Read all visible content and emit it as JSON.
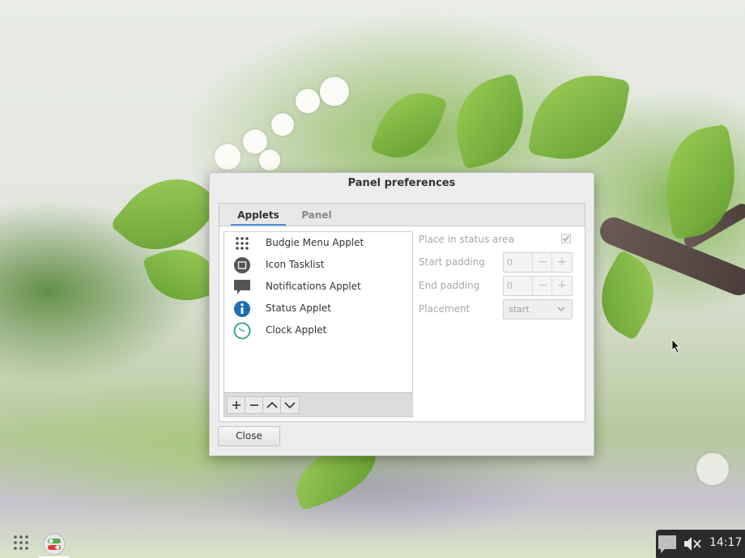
{
  "dialog": {
    "title": "Panel preferences",
    "tabs": [
      {
        "label": "Applets",
        "active": true
      },
      {
        "label": "Panel",
        "active": false
      }
    ],
    "applets": [
      {
        "label": "Budgie Menu Applet",
        "icon": "grid-dots-icon"
      },
      {
        "label": "Icon Tasklist",
        "icon": "tasklist-icon"
      },
      {
        "label": "Notifications Applet",
        "icon": "notification-bubble-icon"
      },
      {
        "label": "Status Applet",
        "icon": "info-icon"
      },
      {
        "label": "Clock Applet",
        "icon": "clock-icon"
      }
    ],
    "list_toolbar": {
      "add_icon": "plus-icon",
      "remove_icon": "minus-icon",
      "move_up_icon": "chevron-up-icon",
      "move_down_icon": "chevron-down-icon"
    },
    "settings": {
      "status_area_label": "Place in status area",
      "status_area_checked": true,
      "start_padding_label": "Start padding",
      "start_padding_value": "0",
      "end_padding_label": "End padding",
      "end_padding_value": "0",
      "placement_label": "Placement",
      "placement_value": "start"
    },
    "close_label": "Close"
  },
  "panel": {
    "launcher_icon": "app-grid-icon",
    "running_app_icon": "settings-toggle-icon",
    "tray": {
      "notification_icon": "notification-bubble-icon",
      "sound_icon": "volume-muted-icon",
      "clock": "14:17"
    }
  },
  "colors": {
    "accent": "#4a90d9",
    "info_blue": "#1f6fb3",
    "clock_teal": "#2a9d8f",
    "tray_bg": "#2b2b2b"
  }
}
